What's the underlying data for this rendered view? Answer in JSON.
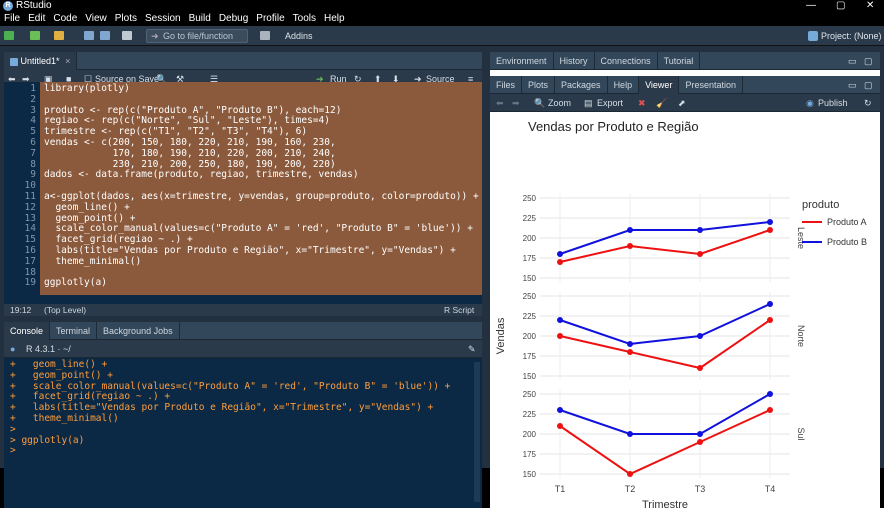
{
  "app": {
    "title": "RStudio"
  },
  "menu": [
    "File",
    "Edit",
    "Code",
    "View",
    "Plots",
    "Session",
    "Build",
    "Debug",
    "Profile",
    "Tools",
    "Help"
  ],
  "toolbar": {
    "goto_placeholder": "Go to file/function",
    "addins": "Addins",
    "project": "Project: (None)"
  },
  "editor": {
    "tab": "Untitled1*",
    "source_on_save": "Source on Save",
    "run": "Run",
    "source": "Source",
    "line_numbers": [
      "1",
      "2",
      "3",
      "4",
      "5",
      "6",
      "7",
      "8",
      "9",
      "10",
      "11",
      "12",
      "13",
      "14",
      "15",
      "16",
      "17",
      "18",
      "19"
    ],
    "lines": [
      "library(plotly)",
      "",
      "produto <- rep(c(\"Produto A\", \"Produto B\"), each=12)",
      "regiao <- rep(c(\"Norte\", \"Sul\", \"Leste\"), times=4)",
      "trimestre <- rep(c(\"T1\", \"T2\", \"T3\", \"T4\"), 6)",
      "vendas <- c(200, 150, 180, 220, 210, 190, 160, 230,",
      "            170, 180, 190, 210, 220, 200, 210, 240,",
      "            230, 210, 200, 250, 180, 190, 200, 220)",
      "dados <- data.frame(produto, regiao, trimestre, vendas)",
      "",
      "a<-ggplot(dados, aes(x=trimestre, y=vendas, group=produto, color=produto)) +",
      "  geom_line() +",
      "  geom_point() +",
      "  scale_color_manual(values=c(\"Produto A\" = 'red', \"Produto B\" = 'blue')) +",
      "  facet_grid(regiao ~ .) +",
      "  labs(title=\"Vendas por Produto e Região\", x=\"Trimestre\", y=\"Vendas\") +",
      "  theme_minimal()",
      "",
      "ggplotly(a)"
    ],
    "status_pos": "19:12",
    "status_level": "(Top Level)",
    "status_type": "R Script"
  },
  "console": {
    "tabs": [
      "Console",
      "Terminal",
      "Background Jobs"
    ],
    "version": "R 4.3.1 · ~/",
    "lines": [
      "+   geom_line() +",
      "+   geom_point() +",
      "+   scale_color_manual(values=c(\"Produto A\" = 'red', \"Produto B\" = 'blue')) +",
      "+   facet_grid(regiao ~ .) +",
      "+   labs(title=\"Vendas por Produto e Região\", x=\"Trimestre\", y=\"Vendas\") +",
      "+   theme_minimal()",
      ">",
      "> ggplotly(a)",
      ">"
    ]
  },
  "right": {
    "top_tabs": [
      "Environment",
      "History",
      "Connections",
      "Tutorial"
    ],
    "tabs": [
      "Files",
      "Plots",
      "Packages",
      "Help",
      "Viewer",
      "Presentation"
    ],
    "active_tab": "Viewer",
    "zoom": "Zoom",
    "export": "Export",
    "publish": "Publish"
  },
  "colors": {
    "red": "#ee1111",
    "blue": "#1111dd",
    "editor_bg": "#0b2945",
    "selection": "#8b5a3c"
  },
  "chart_data": {
    "type": "line",
    "title": "Vendas por Produto e Região",
    "xlabel": "Trimestre",
    "ylabel": "Vendas",
    "categories": [
      "T1",
      "T2",
      "T3",
      "T4"
    ],
    "yticks": [
      150,
      175,
      200,
      225,
      250
    ],
    "ylim": [
      145,
      255
    ],
    "legend_title": "produto",
    "legend_placement": "top-right",
    "facets": [
      {
        "name": "Leste",
        "series": [
          {
            "name": "Produto A",
            "color": "#ee1111",
            "values": [
              170,
              190,
              180,
              210
            ]
          },
          {
            "name": "Produto B",
            "color": "#1111dd",
            "values": [
              180,
              210,
              210,
              220
            ]
          }
        ]
      },
      {
        "name": "Norte",
        "series": [
          {
            "name": "Produto A",
            "color": "#ee1111",
            "values": [
              200,
              180,
              160,
              220
            ]
          },
          {
            "name": "Produto B",
            "color": "#1111dd",
            "values": [
              220,
              190,
              200,
              240
            ]
          }
        ]
      },
      {
        "name": "Sul",
        "series": [
          {
            "name": "Produto A",
            "color": "#ee1111",
            "values": [
              210,
              150,
              190,
              230
            ]
          },
          {
            "name": "Produto B",
            "color": "#1111dd",
            "values": [
              230,
              200,
              200,
              250
            ]
          }
        ]
      }
    ]
  }
}
